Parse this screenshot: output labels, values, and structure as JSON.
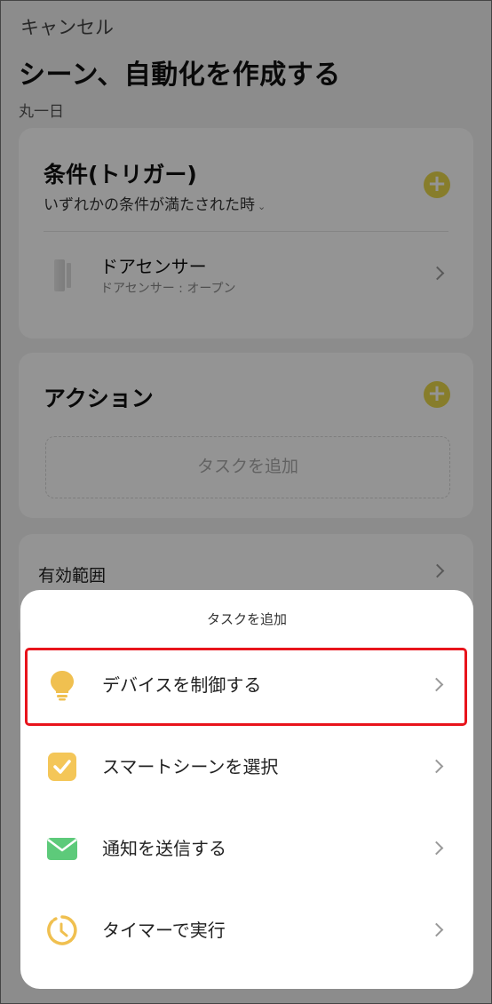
{
  "header": {
    "cancel_label": "キャンセル",
    "title": "シーン、自動化を作成する",
    "subtitle": "丸一日"
  },
  "trigger": {
    "title": "条件(トリガー)",
    "mode": "いずれかの条件が満たされた時",
    "device_name": "ドアセンサー",
    "device_status": "ドアセンサー : オープン"
  },
  "action": {
    "title": "アクション",
    "placeholder": "タスクを追加"
  },
  "range": {
    "label": "有効範囲"
  },
  "sheet": {
    "title": "タスクを追加",
    "options": [
      {
        "label": "デバイスを制御する",
        "icon": "lightbulb-icon"
      },
      {
        "label": "スマートシーンを選択",
        "icon": "checkbox-icon"
      },
      {
        "label": "通知を送信する",
        "icon": "envelope-icon"
      },
      {
        "label": "タイマーで実行",
        "icon": "timer-icon"
      }
    ]
  },
  "colors": {
    "accent": "#e8d84a",
    "highlight": "#e8141c",
    "bulb": "#f0c050",
    "envelope": "#5dca7a"
  }
}
